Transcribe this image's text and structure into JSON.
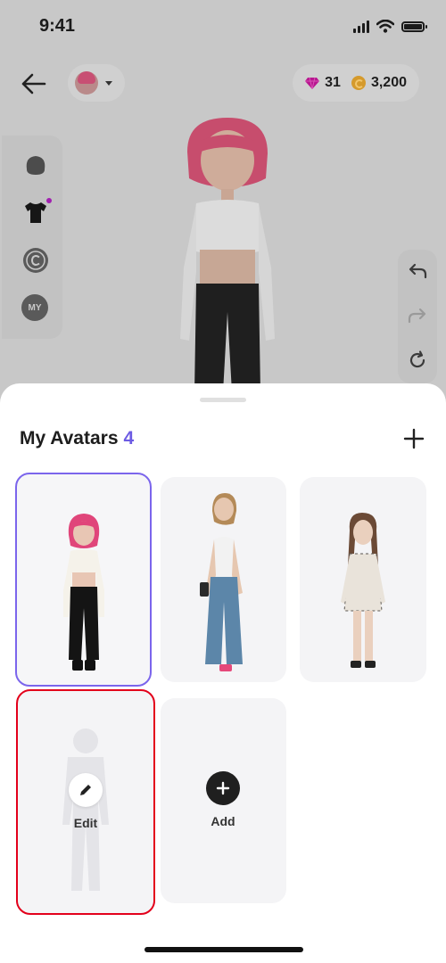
{
  "status_bar": {
    "time": "9:41"
  },
  "header": {
    "gems": "31",
    "coins": "3,200"
  },
  "sheet": {
    "title": "My Avatars",
    "count": "4",
    "edit_label": "Edit",
    "add_label": "Add"
  },
  "colors": {
    "accent": "#7b65ec",
    "highlight": "#e3001b",
    "gem": "#c2159a",
    "coin": "#d59a2c"
  }
}
